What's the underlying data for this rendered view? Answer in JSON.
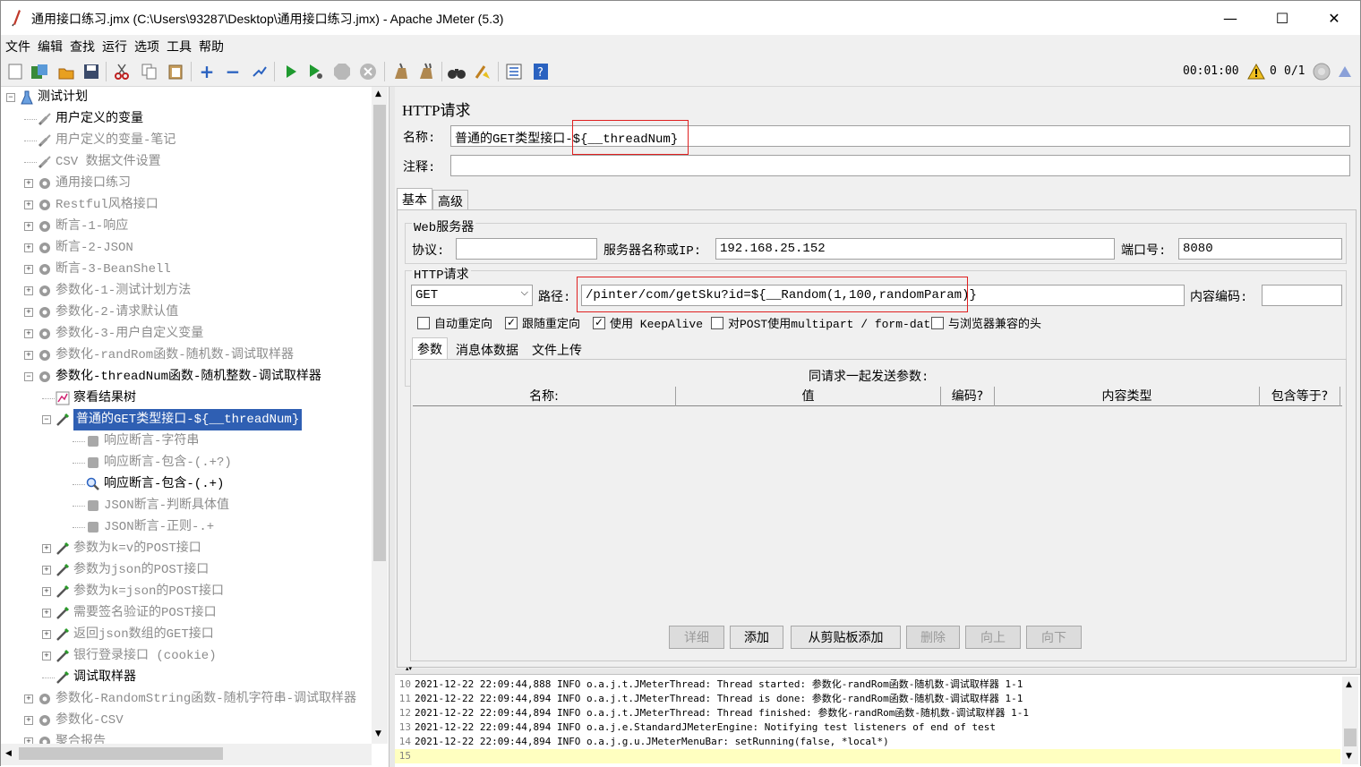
{
  "window": {
    "title": "通用接口练习.jmx (C:\\Users\\93287\\Desktop\\通用接口练习.jmx) - Apache JMeter (5.3)",
    "minimize": "—",
    "maximize": "☐",
    "close": "✕"
  },
  "menu": [
    "文件",
    "编辑",
    "查找",
    "运行",
    "选项",
    "工具",
    "帮助"
  ],
  "toolbar": {
    "timer": "00:01:00",
    "warn_count": "0",
    "threads": "0/1"
  },
  "tree": [
    {
      "label": "测试计划",
      "level": 0,
      "exp": "−",
      "icon": "flask-icon",
      "state": "normal"
    },
    {
      "label": "用户定义的变量",
      "level": 1,
      "exp": "",
      "icon": "wrench-icon",
      "state": "normal"
    },
    {
      "label": "用户定义的变量-笔记",
      "level": 1,
      "exp": "",
      "icon": "wrench-icon",
      "state": "disabled"
    },
    {
      "label": "CSV 数据文件设置",
      "level": 1,
      "exp": "",
      "icon": "wrench-icon",
      "state": "disabled"
    },
    {
      "label": "通用接口练习",
      "level": 1,
      "exp": "+",
      "icon": "gear-icon",
      "state": "disabled"
    },
    {
      "label": "Restful风格接口",
      "level": 1,
      "exp": "+",
      "icon": "gear-icon",
      "state": "disabled"
    },
    {
      "label": "断言-1-响应",
      "level": 1,
      "exp": "+",
      "icon": "gear-icon",
      "state": "disabled"
    },
    {
      "label": "断言-2-JSON",
      "level": 1,
      "exp": "+",
      "icon": "gear-icon",
      "state": "disabled"
    },
    {
      "label": "断言-3-BeanShell",
      "level": 1,
      "exp": "+",
      "icon": "gear-icon",
      "state": "disabled"
    },
    {
      "label": "参数化-1-测试计划方法",
      "level": 1,
      "exp": "+",
      "icon": "gear-icon",
      "state": "disabled"
    },
    {
      "label": "参数化-2-请求默认值",
      "level": 1,
      "exp": "+",
      "icon": "gear-icon",
      "state": "disabled"
    },
    {
      "label": "参数化-3-用户自定义变量",
      "level": 1,
      "exp": "+",
      "icon": "gear-icon",
      "state": "disabled"
    },
    {
      "label": "参数化-randRom函数-随机数-调试取样器",
      "level": 1,
      "exp": "+",
      "icon": "gear-icon",
      "state": "disabled"
    },
    {
      "label": "参数化-threadNum函数-随机整数-调试取样器",
      "level": 1,
      "exp": "−",
      "icon": "gear-icon",
      "state": "normal"
    },
    {
      "label": "察看结果树",
      "level": 2,
      "exp": "",
      "icon": "chart-icon",
      "state": "normal"
    },
    {
      "label": "普通的GET类型接口-${__threadNum}",
      "level": 2,
      "exp": "−",
      "icon": "pipette-icon",
      "state": "selected"
    },
    {
      "label": "响应断言-字符串",
      "level": 3,
      "exp": "",
      "icon": "assert-icon",
      "state": "disabled"
    },
    {
      "label": "响应断言-包含-(.+?)",
      "level": 3,
      "exp": "",
      "icon": "assert-icon",
      "state": "disabled"
    },
    {
      "label": "响应断言-包含-(.+)",
      "level": 3,
      "exp": "",
      "icon": "magnifier-icon",
      "state": "normal"
    },
    {
      "label": "JSON断言-判断具体值",
      "level": 3,
      "exp": "",
      "icon": "assert-icon",
      "state": "disabled"
    },
    {
      "label": "JSON断言-正则-.+",
      "level": 3,
      "exp": "",
      "icon": "assert-icon",
      "state": "disabled"
    },
    {
      "label": "参数为k=v的POST接口",
      "level": 2,
      "exp": "+",
      "icon": "pipette-icon",
      "state": "disabled"
    },
    {
      "label": "参数为json的POST接口",
      "level": 2,
      "exp": "+",
      "icon": "pipette-icon",
      "state": "disabled"
    },
    {
      "label": "参数为k=json的POST接口",
      "level": 2,
      "exp": "+",
      "icon": "pipette-icon",
      "state": "disabled"
    },
    {
      "label": "需要签名验证的POST接口",
      "level": 2,
      "exp": "+",
      "icon": "pipette-icon",
      "state": "disabled"
    },
    {
      "label": "返回json数组的GET接口",
      "level": 2,
      "exp": "+",
      "icon": "pipette-icon",
      "state": "disabled"
    },
    {
      "label": "银行登录接口 (cookie)",
      "level": 2,
      "exp": "+",
      "icon": "pipette-icon",
      "state": "disabled"
    },
    {
      "label": "调试取样器",
      "level": 2,
      "exp": "",
      "icon": "pipette-icon",
      "state": "normal"
    },
    {
      "label": "参数化-RandomString函数-随机字符串-调试取样器",
      "level": 1,
      "exp": "+",
      "icon": "gear-icon",
      "state": "disabled"
    },
    {
      "label": "参数化-CSV",
      "level": 1,
      "exp": "+",
      "icon": "gear-icon",
      "state": "disabled"
    },
    {
      "label": "聚合报告",
      "level": 1,
      "exp": "+",
      "icon": "gear-icon",
      "state": "disabled"
    }
  ],
  "panel": {
    "title": "HTTP请求",
    "name_label": "名称:",
    "name_value": "普通的GET类型接口-${__threadNum}",
    "comment_label": "注释:",
    "comment_value": "",
    "tab_basic": "基本",
    "tab_advanced": "高级",
    "web_server_title": "Web服务器",
    "protocol_label": "协议:",
    "protocol_value": "",
    "server_label": "服务器名称或IP:",
    "server_value": "192.168.25.152",
    "port_label": "端口号:",
    "port_value": "8080",
    "http_request_title": "HTTP请求",
    "method_value": "GET",
    "path_label": "路径:",
    "path_value": "/pinter/com/getSku?id=${__Random(1,100,randomParam)}",
    "encoding_label": "内容编码:",
    "encoding_value": "",
    "checkboxes": [
      {
        "label": "自动重定向",
        "checked": false
      },
      {
        "label": "跟随重定向",
        "checked": true
      },
      {
        "label": "使用 KeepAlive",
        "checked": true
      },
      {
        "label": "对POST使用multipart / form-data",
        "checked": false
      },
      {
        "label": "与浏览器兼容的头",
        "checked": false
      }
    ],
    "sub_tabs": [
      "参数",
      "消息体数据",
      "文件上传"
    ],
    "params_caption": "同请求一起发送参数:",
    "params_columns": [
      "名称:",
      "值",
      "编码?",
      "内容类型",
      "包含等于?"
    ],
    "buttons": [
      {
        "label": "详细",
        "enabled": false
      },
      {
        "label": "添加",
        "enabled": true
      },
      {
        "label": "从剪贴板添加",
        "enabled": true
      },
      {
        "label": "删除",
        "enabled": false
      },
      {
        "label": "向上",
        "enabled": false
      },
      {
        "label": "向下",
        "enabled": false
      }
    ]
  },
  "log": [
    {
      "ln": "10",
      "text": "2021-12-22 22:09:44,888 INFO o.a.j.t.JMeterThread: Thread started: 参数化-randRom函数-随机数-调试取样器 1-1"
    },
    {
      "ln": "11",
      "text": "2021-12-22 22:09:44,894 INFO o.a.j.t.JMeterThread: Thread is done: 参数化-randRom函数-随机数-调试取样器 1-1"
    },
    {
      "ln": "12",
      "text": "2021-12-22 22:09:44,894 INFO o.a.j.t.JMeterThread: Thread finished: 参数化-randRom函数-随机数-调试取样器 1-1"
    },
    {
      "ln": "13",
      "text": "2021-12-22 22:09:44,894 INFO o.a.j.e.StandardJMeterEngine: Notifying test listeners of end of test"
    },
    {
      "ln": "14",
      "text": "2021-12-22 22:09:44,894 INFO o.a.j.g.u.JMeterMenuBar: setRunning(false, *local*)"
    },
    {
      "ln": "15",
      "text": ""
    }
  ]
}
